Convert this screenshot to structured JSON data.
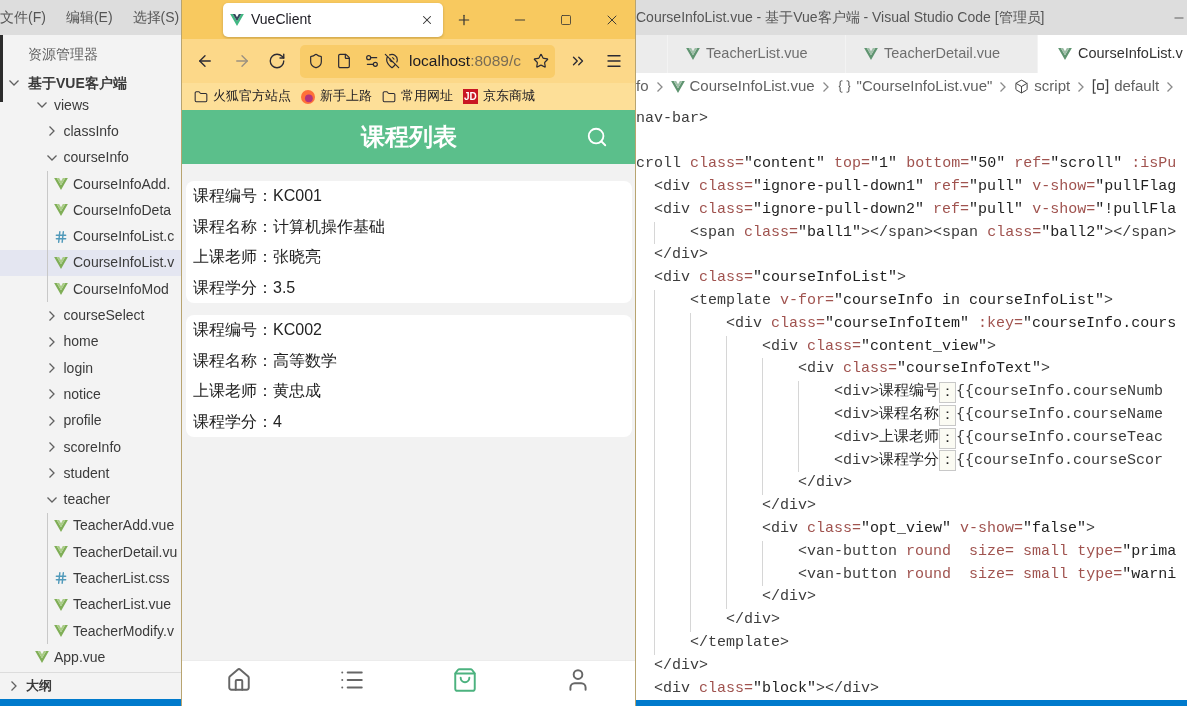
{
  "vscode": {
    "menu": [
      "文件(F)",
      "编辑(E)",
      "选择(S)"
    ],
    "title": "CourseInfoList.vue - 基于Vue客户端 - Visual Studio Code [管理员]"
  },
  "explorer": {
    "title": "资源管理器",
    "root": {
      "label": "基于VUE客户端",
      "expanded": true
    },
    "tree": [
      {
        "kind": "folder",
        "label": "views",
        "expanded": true,
        "selected": false,
        "children": [
          {
            "kind": "folder",
            "label": "classInfo",
            "expanded": false,
            "selected": false
          },
          {
            "kind": "folder",
            "label": "courseInfo",
            "expanded": true,
            "selected": false,
            "children": [
              {
                "kind": "vue",
                "label": "CourseInfoAdd.",
                "selected": false
              },
              {
                "kind": "vue",
                "label": "CourseInfoDeta",
                "selected": false
              },
              {
                "kind": "css",
                "label": "CourseInfoList.c",
                "selected": false
              },
              {
                "kind": "vue",
                "label": "CourseInfoList.v",
                "selected": true
              },
              {
                "kind": "vue",
                "label": "CourseInfoMod",
                "selected": false
              }
            ]
          },
          {
            "kind": "folder",
            "label": "courseSelect",
            "expanded": false,
            "selected": false
          },
          {
            "kind": "folder",
            "label": "home",
            "expanded": false,
            "selected": false
          },
          {
            "kind": "folder",
            "label": "login",
            "expanded": false,
            "selected": false
          },
          {
            "kind": "folder",
            "label": "notice",
            "expanded": false,
            "selected": false
          },
          {
            "kind": "folder",
            "label": "profile",
            "expanded": false,
            "selected": false
          },
          {
            "kind": "folder",
            "label": "scoreInfo",
            "expanded": false,
            "selected": false
          },
          {
            "kind": "folder",
            "label": "student",
            "expanded": false,
            "selected": false
          },
          {
            "kind": "folder",
            "label": "teacher",
            "expanded": true,
            "selected": false,
            "children": [
              {
                "kind": "vue",
                "label": "TeacherAdd.vue",
                "selected": false
              },
              {
                "kind": "vue",
                "label": "TeacherDetail.vu",
                "selected": false
              },
              {
                "kind": "css",
                "label": "TeacherList.css",
                "selected": false
              },
              {
                "kind": "vue",
                "label": "TeacherList.vue",
                "selected": false
              },
              {
                "kind": "vue",
                "label": "TeacherModify.v",
                "selected": false
              }
            ]
          }
        ]
      },
      {
        "kind": "vue",
        "label": "App.vue",
        "selected": false
      }
    ],
    "outline": {
      "label": "大纲",
      "expanded": false
    }
  },
  "browser": {
    "tab": {
      "title": "VueClient"
    },
    "url": {
      "host": "localhost",
      "rest": ":8089/c"
    },
    "bookmarks": [
      {
        "kind": "folder",
        "label": "火狐官方站点"
      },
      {
        "kind": "link",
        "label": "新手上路"
      },
      {
        "kind": "folder",
        "label": "常用网址"
      },
      {
        "kind": "link",
        "label": "京东商城",
        "logo_text": "JD"
      }
    ],
    "page": {
      "title": "课程列表",
      "courses": [
        {
          "lines": [
            "课程编号：KC001",
            "课程名称：计算机操作基础",
            "上课老师：张晓亮",
            "课程学分：3.5"
          ]
        },
        {
          "lines": [
            "课程编号：KC002",
            "课程名称：高等数学",
            "上课老师：黄忠成",
            "课程学分：4"
          ]
        }
      ],
      "nav_items": [
        {
          "selected": false
        },
        {
          "selected": false
        },
        {
          "selected": true
        },
        {
          "selected": false
        }
      ]
    }
  },
  "editor": {
    "tabs": [
      {
        "label": "TeacherList.vue",
        "selected": false
      },
      {
        "label": "TeacherDetail.vue",
        "selected": false
      },
      {
        "label": "CourseInfoList.v",
        "selected": true
      }
    ],
    "breadcrumb": [
      {
        "kind": "folder",
        "label": "fo"
      },
      {
        "kind": "file",
        "label": "CourseInfoList.vue"
      },
      {
        "kind": "module",
        "label": "\"CourseInfoList.vue\""
      },
      {
        "kind": "element",
        "label": "script"
      },
      {
        "kind": "variable",
        "label": "default"
      }
    ],
    "code_lines": [
      {
        "kind": "code",
        "text": "nav-bar>"
      },
      {
        "kind": "blank"
      },
      {
        "kind": "code",
        "text": "croll class=\"content\" top=\"1\" bottom=\"50\" ref=\"scroll\" :isPu",
        "children": [
          {
            "kind": "code",
            "text": "<div class=\"ignore-pull-down1\" ref=\"pull\" v-show=\"pullFlag"
          },
          {
            "kind": "code",
            "text": "<div class=\"ignore-pull-down2\" ref=\"pull\" v-show=\"!pullFla",
            "children": [
              {
                "kind": "code",
                "text": "<span class=\"ball1\"></span><span class=\"ball2\"></span>"
              }
            ]
          },
          {
            "kind": "code",
            "text": "</div>"
          },
          {
            "kind": "code",
            "text": "<div class=\"courseInfoList\">",
            "children": [
              {
                "kind": "code",
                "text": "<template v-for=\"courseInfo in courseInfoList\">",
                "children": [
                  {
                    "kind": "code",
                    "text": "<div class=\"courseInfoItem\" :key=\"courseInfo.cours",
                    "children": [
                      {
                        "kind": "code",
                        "text": "<div class=\"content_view\">",
                        "children": [
                          {
                            "kind": "code",
                            "text": "<div class=\"courseInfoText\">",
                            "children": [
                              {
                                "kind": "marked",
                                "text": "<div>课程编号",
                                "mark": "：",
                                "rest": "{{courseInfo.courseNumb"
                              },
                              {
                                "kind": "marked",
                                "text": "<div>课程名称",
                                "mark": "：",
                                "rest": "{{courseInfo.courseName"
                              },
                              {
                                "kind": "marked",
                                "text": "<div>上课老师",
                                "mark": "：",
                                "rest": "{{courseInfo.courseTeac"
                              },
                              {
                                "kind": "marked",
                                "text": "<div>课程学分",
                                "mark": "：",
                                "rest": "{{courseInfo.courseScor"
                              }
                            ]
                          },
                          {
                            "kind": "code",
                            "text": "</div>"
                          }
                        ]
                      },
                      {
                        "kind": "code",
                        "text": "</div>"
                      },
                      {
                        "kind": "code",
                        "text": "<div class=\"opt_view\" v-show=\"false\">",
                        "children": [
                          {
                            "kind": "code",
                            "text": "<van-button round  size= small type=\"prima"
                          },
                          {
                            "kind": "code",
                            "text": "<van-button round  size= small type=\"warni"
                          }
                        ]
                      },
                      {
                        "kind": "code",
                        "text": "</div>"
                      }
                    ]
                  },
                  {
                    "kind": "code",
                    "text": "</div>"
                  }
                ]
              },
              {
                "kind": "code",
                "text": "</template>"
              }
            ]
          },
          {
            "kind": "code",
            "text": "</div>"
          },
          {
            "kind": "code",
            "text": "<div class=\"block\"></div>"
          }
        ]
      }
    ]
  }
}
